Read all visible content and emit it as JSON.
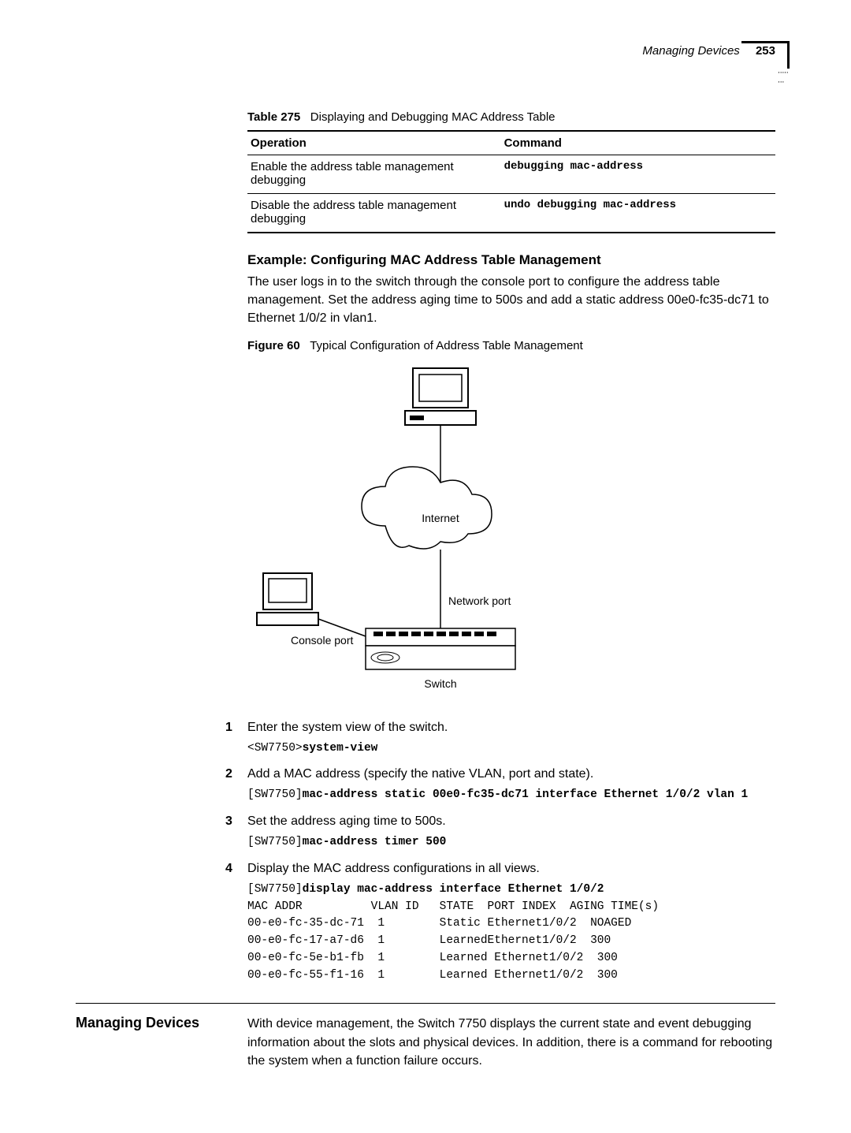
{
  "header": {
    "running_title": "Managing Devices",
    "page_number": "253"
  },
  "table": {
    "caption_label": "Table 275",
    "caption_text": "Displaying and Debugging MAC Address Table",
    "col1": "Operation",
    "col2": "Command",
    "rows": [
      {
        "op": "Enable the address table management debugging",
        "cmd": "debugging mac-address"
      },
      {
        "op": "Disable the address table management debugging",
        "cmd": "undo debugging mac-address"
      }
    ]
  },
  "example": {
    "heading": "Example: Configuring MAC Address Table Management",
    "para": "The user logs in to the switch through the console port to configure the address table management. Set the address aging time to 500s and add a static address 00e0-fc35-dc71 to Ethernet 1/0/2 in vlan1."
  },
  "figure": {
    "caption_label": "Figure 60",
    "caption_text": "Typical Configuration of Address Table Management",
    "labels": {
      "internet": "Internet",
      "network_port": "Network port",
      "console_port": "Console port",
      "switch": "Switch"
    }
  },
  "steps": [
    {
      "num": "1",
      "text": "Enter the system view of the switch.",
      "code_prefix": "<SW7750>",
      "code_bold": "system-view"
    },
    {
      "num": "2",
      "text": "Add a MAC address (specify the native VLAN, port and state).",
      "code_prefix": "[SW7750]",
      "code_bold": "mac-address static 00e0-fc35-dc71 interface Ethernet 1/0/2 vlan 1"
    },
    {
      "num": "3",
      "text": "Set the address aging time to 500s.",
      "code_prefix": "[SW7750]",
      "code_bold": "mac-address timer 500"
    },
    {
      "num": "4",
      "text": "Display the MAC address configurations in all views.",
      "code_prefix": "[SW7750]",
      "code_bold": "display mac-address interface Ethernet 1/0/2",
      "output_header": "MAC ADDR          VLAN ID   STATE  PORT INDEX  AGING TIME(s)",
      "output_rows": [
        "00-e0-fc-35-dc-71  1        Static Ethernet1/0/2  NOAGED",
        "00-e0-fc-17-a7-d6  1        LearnedEthernet1/0/2  300",
        "00-e0-fc-5e-b1-fb  1        Learned Ethernet1/0/2  300",
        "00-e0-fc-55-f1-16  1        Learned Ethernet1/0/2  300"
      ]
    }
  ],
  "section": {
    "heading": "Managing Devices",
    "body": "With device management, the Switch 7750 displays the current state and event debugging information about the slots and physical devices. In addition, there is a command for rebooting the system when a function failure occurs."
  }
}
